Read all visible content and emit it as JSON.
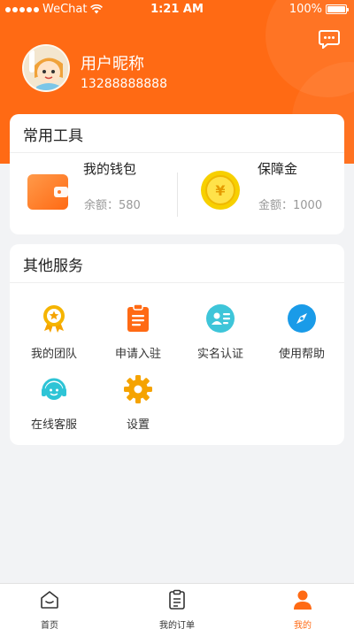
{
  "status_bar": {
    "carrier": "WeChat",
    "time": "1:21 AM",
    "battery": "100%"
  },
  "profile": {
    "nickname": "用户昵称",
    "phone": "13288888888",
    "message_icon": "message-bubble-icon"
  },
  "tools": {
    "title": "常用工具",
    "items": [
      {
        "name": "我的钱包",
        "sub": "余额：580",
        "icon": "wallet-icon"
      },
      {
        "name": "保障金",
        "sub": "金额：1000",
        "icon": "yen-coin-icon"
      }
    ]
  },
  "services": {
    "title": "其他服务",
    "items": [
      {
        "label": "我的团队",
        "icon": "medal-icon"
      },
      {
        "label": "申请入驻",
        "icon": "clipboard-icon"
      },
      {
        "label": "实名认证",
        "icon": "id-card-icon"
      },
      {
        "label": "使用帮助",
        "icon": "compass-icon"
      },
      {
        "label": "在线客服",
        "icon": "headset-icon"
      },
      {
        "label": "设置",
        "icon": "gear-icon"
      }
    ]
  },
  "tabbar": {
    "items": [
      {
        "label": "首页",
        "icon": "home-icon"
      },
      {
        "label": "我的订单",
        "icon": "order-clipboard-icon"
      },
      {
        "label": "我的",
        "icon": "person-icon",
        "active": true
      }
    ]
  },
  "colors": {
    "brand": "#ff6a14",
    "background": "#f2f3f5",
    "gold": "#f5b800"
  }
}
